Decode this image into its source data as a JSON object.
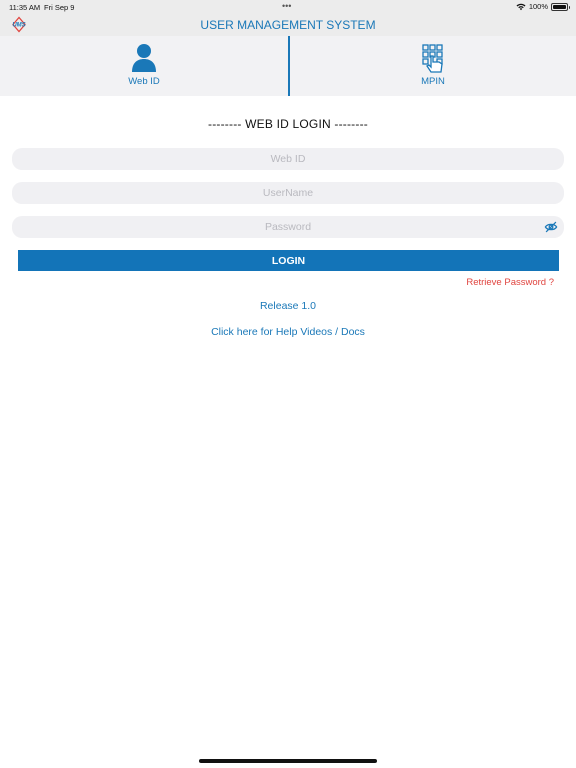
{
  "status_bar": {
    "time": "11:35 AM",
    "date": "Fri Sep 9",
    "dots": "•••",
    "battery_percent": "100%",
    "icons": [
      "wifi-icon",
      "battery-icon"
    ]
  },
  "header": {
    "logo_text": "UMS",
    "title": "USER MANAGEMENT SYSTEM"
  },
  "tabs": [
    {
      "label": "Web ID",
      "icon": "user-icon"
    },
    {
      "label": "MPIN",
      "icon": "keypad-hand-icon"
    }
  ],
  "login": {
    "heading": "-------- WEB ID LOGIN --------",
    "fields": {
      "web_id": {
        "placeholder": "Web ID",
        "value": ""
      },
      "username": {
        "placeholder": "UserName",
        "value": ""
      },
      "password": {
        "placeholder": "Password",
        "value": ""
      }
    },
    "button_label": "LOGIN",
    "retrieve_password": "Retrieve Password  ?",
    "release": "Release 1.0",
    "help_link": "Click here for Help Videos / Docs"
  },
  "colors": {
    "accent": "#1a78b8",
    "button": "#1374b8",
    "link_red": "#e0443f",
    "field_bg": "#f0f0f3",
    "header_bg": "#ececec"
  }
}
